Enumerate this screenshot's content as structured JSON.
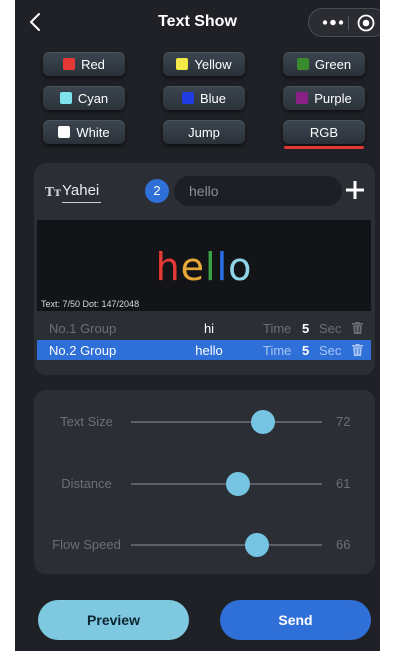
{
  "header": {
    "title": "Text Show"
  },
  "colors": [
    {
      "label": "Red",
      "swatch": "#e53935"
    },
    {
      "label": "Yellow",
      "swatch": "#f5e94a"
    },
    {
      "label": "Green",
      "swatch": "#3a8b2e"
    },
    {
      "label": "Cyan",
      "swatch": "#7fe3ee"
    },
    {
      "label": "Blue",
      "swatch": "#1e3ce0"
    },
    {
      "label": "Purple",
      "swatch": "#8a1f86"
    },
    {
      "label": "White",
      "swatch": "#ffffff"
    },
    {
      "label": "Jump",
      "swatch": null
    },
    {
      "label": "RGB",
      "swatch": null
    }
  ],
  "selected_mode": "RGB",
  "editor": {
    "font_name": "Yahei",
    "count_badge": "2",
    "input_value": "hello",
    "preview_text": "hello",
    "preview_letter_colors": [
      "#e53935",
      "#e8a838",
      "#3aa341",
      "#2a6ee8",
      "#8fd4e8"
    ],
    "stats": "Text: 7/50  Dot: 147/2048"
  },
  "groups": [
    {
      "group": "No.1 Group",
      "text": "hi",
      "time_label": "Time",
      "time_value": "5",
      "unit": "Sec"
    },
    {
      "group": "No.2 Group",
      "text": "hello",
      "time_label": "Time",
      "time_value": "5",
      "unit": "Sec"
    }
  ],
  "selected_group": 1,
  "sliders": [
    {
      "label": "Text Size",
      "value": "72",
      "fraction": 0.69
    },
    {
      "label": "Distance",
      "value": "61",
      "fraction": 0.56
    },
    {
      "label": "Flow Speed",
      "value": "66",
      "fraction": 0.66
    }
  ],
  "buttons": {
    "preview": "Preview",
    "send": "Send"
  }
}
